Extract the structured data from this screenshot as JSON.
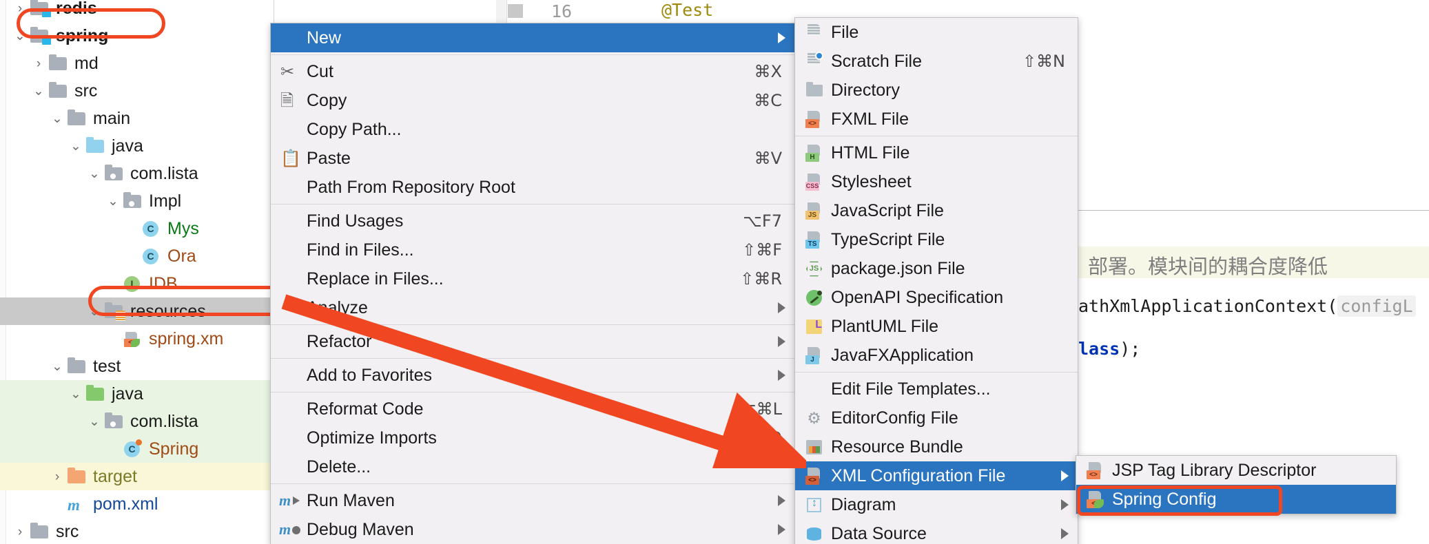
{
  "app": "IntelliJ IDEA project view with New file context menu",
  "editor": {
    "line_number": "16",
    "annotation": "@Test",
    "chinese_comment": "、部署。模块间的耦合度降低",
    "code_line_1": "athXmlApplicationContext(",
    "code_param": "configL",
    "code_line_2_kw": "lass",
    "code_line_2_rest": ");"
  },
  "tree": {
    "items": [
      {
        "label": "redis",
        "icon": "module-folder-icon",
        "arrow": "collapsed",
        "indent": 0,
        "bold": true,
        "color": "default",
        "rowbg": "none"
      },
      {
        "label": "spring",
        "icon": "module-folder-icon",
        "arrow": "expanded",
        "indent": 0,
        "bold": true,
        "color": "default",
        "rowbg": "none"
      },
      {
        "label": "md",
        "icon": "folder-icon",
        "arrow": "collapsed",
        "indent": 1,
        "bold": false,
        "color": "default",
        "rowbg": "none"
      },
      {
        "label": "src",
        "icon": "folder-icon",
        "arrow": "expanded",
        "indent": 1,
        "bold": false,
        "color": "default",
        "rowbg": "none"
      },
      {
        "label": "main",
        "icon": "folder-icon",
        "arrow": "expanded",
        "indent": 2,
        "bold": false,
        "color": "default",
        "rowbg": "none"
      },
      {
        "label": "java",
        "icon": "source-folder-icon",
        "arrow": "expanded",
        "indent": 3,
        "bold": false,
        "color": "default",
        "rowbg": "none"
      },
      {
        "label": "com.lista",
        "icon": "package-icon",
        "arrow": "expanded",
        "indent": 4,
        "bold": false,
        "color": "default",
        "rowbg": "none"
      },
      {
        "label": "Impl",
        "icon": "package-icon",
        "arrow": "expanded",
        "indent": 5,
        "bold": false,
        "color": "default",
        "rowbg": "none"
      },
      {
        "label": "Mys",
        "icon": "class-icon",
        "arrow": "none",
        "indent": 6,
        "bold": false,
        "color": "green",
        "rowbg": "none"
      },
      {
        "label": "Ora",
        "icon": "class-icon",
        "arrow": "none",
        "indent": 6,
        "bold": false,
        "color": "brown",
        "rowbg": "none"
      },
      {
        "label": "IDB",
        "icon": "interface-icon",
        "arrow": "none",
        "indent": 5,
        "bold": false,
        "color": "brown",
        "rowbg": "none"
      },
      {
        "label": "resources",
        "icon": "resource-folder-icon",
        "arrow": "expanded",
        "indent": 4,
        "bold": false,
        "color": "default",
        "rowbg": "selected"
      },
      {
        "label": "spring.xm",
        "icon": "spring-xml-icon",
        "arrow": "none",
        "indent": 5,
        "bold": false,
        "color": "brown",
        "rowbg": "none"
      },
      {
        "label": "test",
        "icon": "folder-icon",
        "arrow": "expanded",
        "indent": 2,
        "bold": false,
        "color": "default",
        "rowbg": "none"
      },
      {
        "label": "java",
        "icon": "test-source-folder-icon",
        "arrow": "expanded",
        "indent": 3,
        "bold": false,
        "color": "default",
        "rowbg": "green"
      },
      {
        "label": "com.lista",
        "icon": "package-icon",
        "arrow": "expanded",
        "indent": 4,
        "bold": false,
        "color": "default",
        "rowbg": "green"
      },
      {
        "label": "Spring",
        "icon": "spring-class-icon",
        "arrow": "none",
        "indent": 5,
        "bold": false,
        "color": "brown",
        "rowbg": "green"
      },
      {
        "label": "target",
        "icon": "excluded-folder-icon",
        "arrow": "collapsed",
        "indent": 2,
        "bold": false,
        "color": "olive",
        "rowbg": "yellow"
      },
      {
        "label": "pom.xml",
        "icon": "maven-pom-icon",
        "arrow": "none",
        "indent": 2,
        "bold": false,
        "color": "blue",
        "rowbg": "none"
      },
      {
        "label": "src",
        "icon": "folder-icon",
        "arrow": "collapsed",
        "indent": 0,
        "bold": false,
        "color": "default",
        "rowbg": "none"
      }
    ]
  },
  "context_menu": {
    "groups": [
      [
        {
          "label": "New",
          "icon": "none",
          "shortcut": "",
          "submenu": true,
          "highlighted": true
        }
      ],
      [
        {
          "label": "Cut",
          "icon": "scissors-icon",
          "shortcut": "⌘X",
          "submenu": false,
          "highlighted": false
        },
        {
          "label": "Copy",
          "icon": "copy-icon",
          "shortcut": "⌘C",
          "submenu": false,
          "highlighted": false
        },
        {
          "label": "Copy Path...",
          "icon": "none",
          "shortcut": "",
          "submenu": false,
          "highlighted": false
        },
        {
          "label": "Paste",
          "icon": "paste-icon",
          "shortcut": "⌘V",
          "submenu": false,
          "highlighted": false
        },
        {
          "label": "Path From Repository Root",
          "icon": "none",
          "shortcut": "",
          "submenu": false,
          "highlighted": false
        }
      ],
      [
        {
          "label": "Find Usages",
          "icon": "none",
          "shortcut": "⌥F7",
          "submenu": false,
          "highlighted": false
        },
        {
          "label": "Find in Files...",
          "icon": "none",
          "shortcut": "⇧⌘F",
          "submenu": false,
          "highlighted": false
        },
        {
          "label": "Replace in Files...",
          "icon": "none",
          "shortcut": "⇧⌘R",
          "submenu": false,
          "highlighted": false
        },
        {
          "label": "Analyze",
          "icon": "none",
          "shortcut": "",
          "submenu": true,
          "highlighted": false
        }
      ],
      [
        {
          "label": "Refactor",
          "icon": "none",
          "shortcut": "",
          "submenu": true,
          "highlighted": false
        }
      ],
      [
        {
          "label": "Add to Favorites",
          "icon": "none",
          "shortcut": "",
          "submenu": true,
          "highlighted": false
        }
      ],
      [
        {
          "label": "Reformat Code",
          "icon": "none",
          "shortcut": "⌥⌘L",
          "submenu": false,
          "highlighted": false
        },
        {
          "label": "Optimize Imports",
          "icon": "none",
          "shortcut": "⌃⌥O",
          "submenu": false,
          "highlighted": false
        },
        {
          "label": "Delete...",
          "icon": "none",
          "shortcut": "",
          "submenu": false,
          "highlighted": false
        }
      ],
      [
        {
          "label": "Run Maven",
          "icon": "maven-run-icon",
          "shortcut": "",
          "submenu": true,
          "highlighted": false
        },
        {
          "label": "Debug Maven",
          "icon": "maven-debug-icon",
          "shortcut": "",
          "submenu": true,
          "highlighted": false
        }
      ]
    ]
  },
  "new_submenu": {
    "groups": [
      [
        {
          "label": "File",
          "icon": "file-icon",
          "shortcut": "",
          "submenu": false,
          "highlighted": false
        },
        {
          "label": "Scratch File",
          "icon": "scratch-file-icon",
          "shortcut": "⇧⌘N",
          "submenu": false,
          "highlighted": false
        },
        {
          "label": "Directory",
          "icon": "directory-icon",
          "shortcut": "",
          "submenu": false,
          "highlighted": false
        },
        {
          "label": "FXML File",
          "icon": "fxml-file-icon",
          "shortcut": "",
          "submenu": false,
          "highlighted": false
        }
      ],
      [
        {
          "label": "HTML File",
          "icon": "html-file-icon",
          "shortcut": "",
          "submenu": false,
          "highlighted": false
        },
        {
          "label": "Stylesheet",
          "icon": "css-file-icon",
          "shortcut": "",
          "submenu": false,
          "highlighted": false
        },
        {
          "label": "JavaScript File",
          "icon": "js-file-icon",
          "shortcut": "",
          "submenu": false,
          "highlighted": false
        },
        {
          "label": "TypeScript File",
          "icon": "ts-file-icon",
          "shortcut": "",
          "submenu": false,
          "highlighted": false
        },
        {
          "label": "package.json File",
          "icon": "nodejs-icon",
          "shortcut": "",
          "submenu": false,
          "highlighted": false
        },
        {
          "label": "OpenAPI Specification",
          "icon": "openapi-icon",
          "shortcut": "",
          "submenu": false,
          "highlighted": false
        },
        {
          "label": "PlantUML File",
          "icon": "plantuml-icon",
          "shortcut": "",
          "submenu": false,
          "highlighted": false
        },
        {
          "label": "JavaFXApplication",
          "icon": "javafx-icon",
          "shortcut": "",
          "submenu": false,
          "highlighted": false
        }
      ],
      [
        {
          "label": "Edit File Templates...",
          "icon": "none",
          "shortcut": "",
          "submenu": false,
          "highlighted": false
        },
        {
          "label": "EditorConfig File",
          "icon": "gear-icon",
          "shortcut": "",
          "submenu": false,
          "highlighted": false
        },
        {
          "label": "Resource Bundle",
          "icon": "resource-bundle-icon",
          "shortcut": "",
          "submenu": false,
          "highlighted": false
        },
        {
          "label": "XML Configuration File",
          "icon": "xml-config-icon",
          "shortcut": "",
          "submenu": true,
          "highlighted": true
        },
        {
          "label": "Diagram",
          "icon": "diagram-icon",
          "shortcut": "",
          "submenu": true,
          "highlighted": false
        },
        {
          "label": "Data Source",
          "icon": "data-source-icon",
          "shortcut": "",
          "submenu": true,
          "highlighted": false
        }
      ]
    ]
  },
  "xml_config_submenu": {
    "items": [
      {
        "label": "JSP Tag Library Descriptor",
        "icon": "jsp-tld-icon",
        "highlighted": false
      },
      {
        "label": "Spring Config",
        "icon": "spring-config-icon",
        "highlighted": true
      }
    ]
  },
  "annotations": {
    "accent_color": "#f04722",
    "highlight_color": "#2b74bf",
    "boxes": [
      "spring-module-box",
      "resources-folder-box",
      "spring-config-box"
    ],
    "arrow": "red-arrow-pointing-to-xml-configuration-file"
  }
}
